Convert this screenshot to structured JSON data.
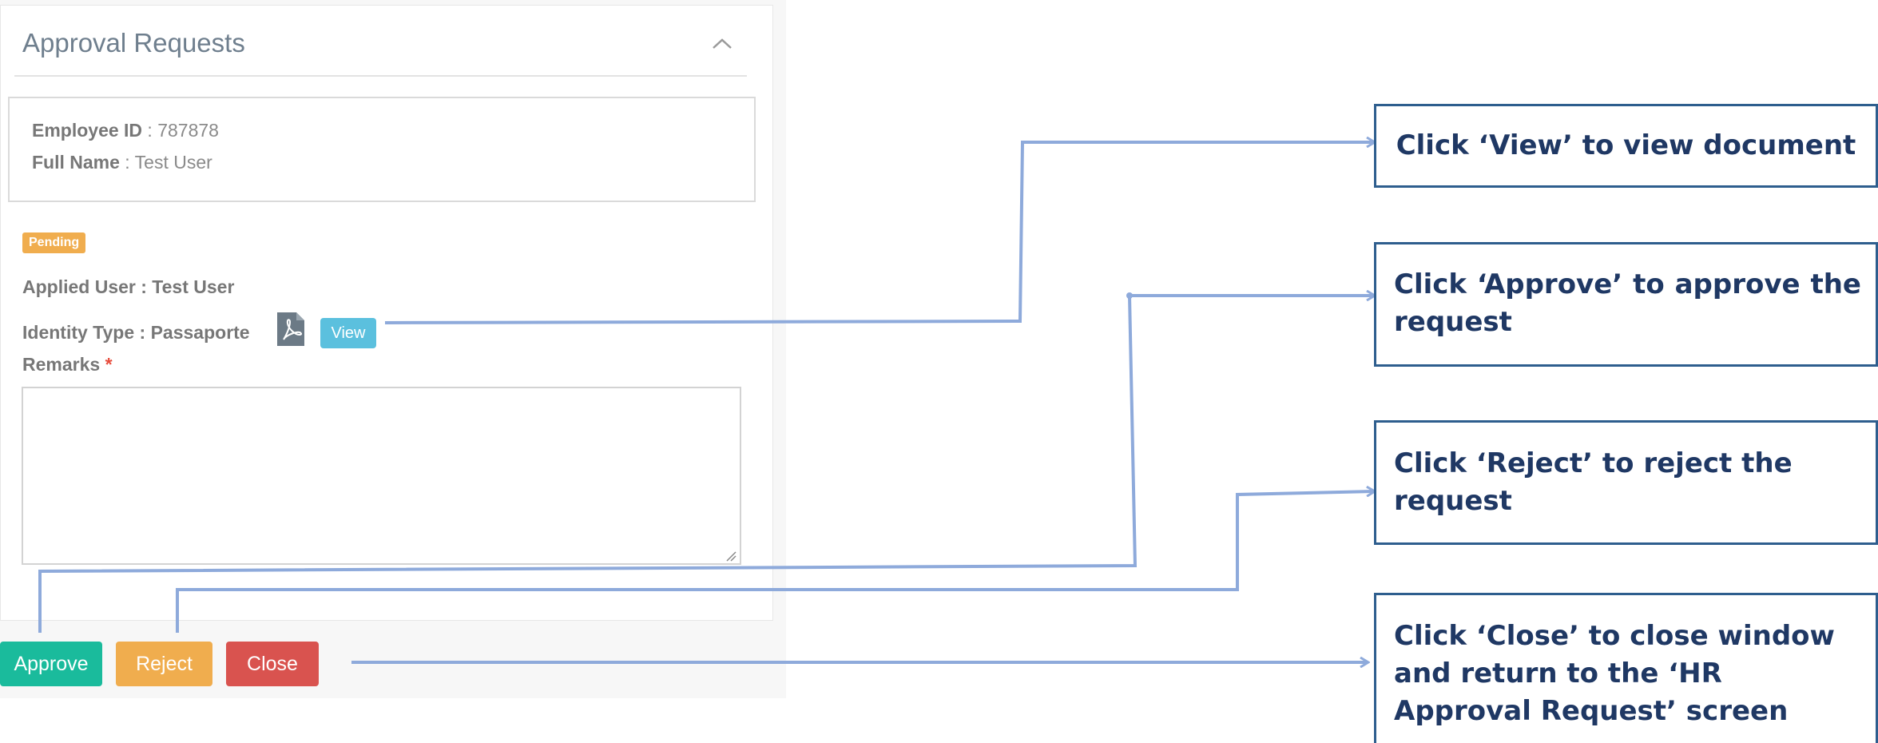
{
  "panel": {
    "title": "Approval Requests"
  },
  "employee": {
    "id_label": "Employee ID",
    "id_value": " : 787878",
    "name_label": "Full Name",
    "name_value": " : Test User"
  },
  "status_badge": "Pending",
  "request": {
    "applied_user": "Applied User : Test User",
    "identity_type": "Identity Type : Passaporte",
    "view_label": "View",
    "remarks_label": "Remarks",
    "required_mark": " *",
    "remarks_value": ""
  },
  "actions": {
    "approve_label": "Approve",
    "reject_label": "Reject",
    "close_label": "Close"
  },
  "callouts": {
    "view": "Click  ‘View’  to view document",
    "approve": "Click   ‘Approve’  to  approve  the request",
    "reject": "Click  ‘Reject’ to reject the request",
    "close": "Click  ‘Close’ to close window and return to the ‘HR Approval Request’ screen"
  },
  "colors": {
    "approve": "#1abb9c",
    "reject": "#f0ad4e",
    "close": "#d9534f",
    "view": "#5bc0de",
    "pending": "#f0ad4e",
    "callout_text": "#1f3864",
    "callout_border": "#2e5e8e",
    "connector": "#8eaadb"
  },
  "icons": {
    "collapse": "chevron-up-icon",
    "document": "pdf-file-icon",
    "resize": "resize-grip-icon"
  }
}
